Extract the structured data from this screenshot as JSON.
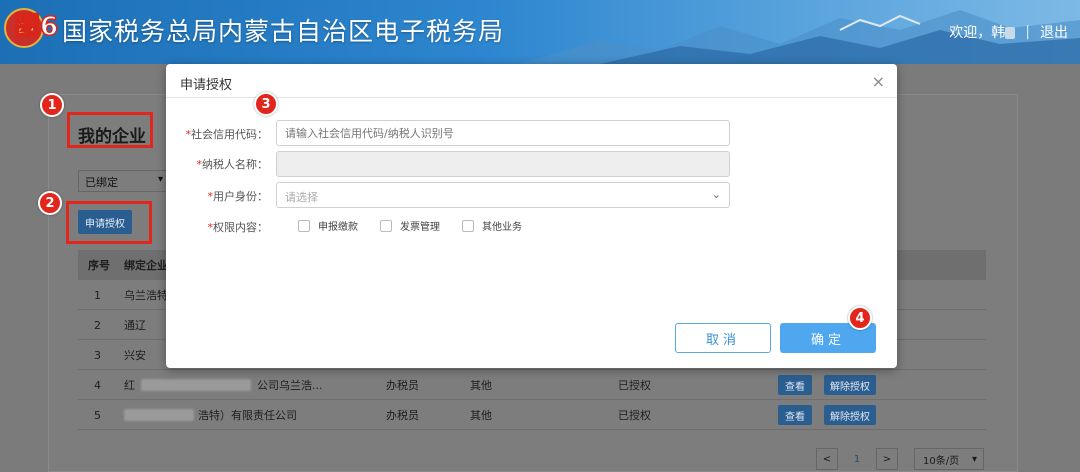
{
  "header": {
    "figure_tag": "图6",
    "title": "国家税务总局内蒙古自治区电子税务局",
    "welcome": "欢迎，韩",
    "separator": "|",
    "logout": "退出"
  },
  "page": {
    "heading": "我的企业",
    "bind_filter": "已绑定",
    "apply_button": "申请授权"
  },
  "annotations": [
    "1",
    "2",
    "3",
    "4"
  ],
  "table": {
    "headers": [
      "序号",
      "绑定企业"
    ],
    "rows": [
      {
        "no": "1",
        "company": "乌兰浩特",
        "role": "",
        "type": "",
        "status": ""
      },
      {
        "no": "2",
        "company": "通辽",
        "role": "",
        "type": "",
        "status": ""
      },
      {
        "no": "3",
        "company": "兴安",
        "role": "",
        "type": "",
        "status": ""
      },
      {
        "no": "4",
        "company": "红",
        "company_tail": "公司乌兰浩...",
        "role": "办税员",
        "type": "其他",
        "status": "已授权",
        "view": "查看",
        "revoke": "解除授权"
      },
      {
        "no": "5",
        "company": "",
        "company_tail": "浩特）有限责任公司",
        "role": "办税员",
        "type": "其他",
        "status": "已授权",
        "view": "查看",
        "revoke": "解除授权"
      }
    ]
  },
  "pager": {
    "prev": "<",
    "page": "1",
    "next": ">",
    "page_size": "10条/页"
  },
  "modal": {
    "title": "申请授权",
    "close": "×",
    "fields": {
      "credit_code": {
        "label": "社会信用代码：",
        "placeholder": "请输入社会信用代码/纳税人识别号"
      },
      "taxpayer_name": {
        "label": "纳税人名称："
      },
      "user_role": {
        "label": "用户身份：",
        "placeholder": "请选择"
      },
      "permission": {
        "label": "权限内容：",
        "options": [
          "申报缴款",
          "发票管理",
          "其他业务"
        ]
      }
    },
    "required_mark": "*",
    "cancel": "取消",
    "confirm": "确定"
  },
  "colors": {
    "accent": "#4fa7ef",
    "annotation_red": "#e3261c",
    "required": "#e3261c"
  }
}
